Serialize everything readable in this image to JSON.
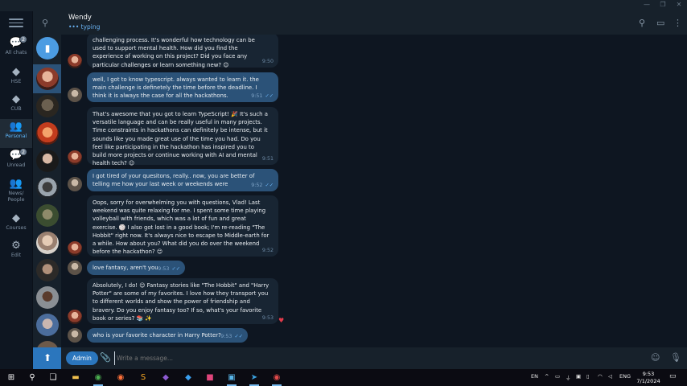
{
  "window": {
    "controls": [
      "—",
      "❐",
      "✕"
    ]
  },
  "rail": {
    "folders": [
      {
        "label": "All chats",
        "badge": "2"
      },
      {
        "label": "HSE",
        "badge": ""
      },
      {
        "label": "CUB",
        "badge": ""
      },
      {
        "label": "Personal",
        "badge": ""
      },
      {
        "label": "Unread",
        "badge": "2"
      },
      {
        "label": "News/ People",
        "badge": ""
      },
      {
        "label": "Courses",
        "badge": ""
      },
      {
        "label": "Edit",
        "badge": ""
      }
    ]
  },
  "header": {
    "name": "Wendy",
    "status": "••• typing"
  },
  "messages": [
    {
      "dir": "in",
      "text": "challenging process. It's wonderful how technology can be used to support mental health. How did you find the experience of working on this project? Did you face any particular challenges or learn something new? 😊",
      "time": "9:50"
    },
    {
      "dir": "out",
      "text": "well, I got to know typescript. always wanted to learn it. the main challenge is definetely the time before the deadline. I think it is always the case for all the hackathons.",
      "time": "9:51"
    },
    {
      "dir": "in",
      "text": "That's awesome that you got to learn TypeScript! 🎉 It's such a versatile language and can be really useful in many projects. Time constraints in hackathons can definitely be intense, but it sounds like you made great use of the time you had. Do you feel like participating in the hackathon has inspired you to build more projects or continue working with AI and mental health tech? 😊",
      "time": "9:51"
    },
    {
      "dir": "out",
      "text": "I got tired of your quesitons, really.. now, you are better of telling me how your last week or weekends were",
      "time": "9:52"
    },
    {
      "dir": "in",
      "text": "Oops, sorry for overwhelming you with questions, Vlad! Last weekend was quite relaxing for me. I spent some time playing volleyball with friends, which was a lot of fun and great exercise. 🏐 I also got lost in a good book; I'm re-reading \"The Hobbit\" right now. It's always nice to escape to Middle-earth for a while. How about you? What did you do over the weekend before the hackathon? 😊",
      "time": "9:52"
    },
    {
      "dir": "out",
      "text": "love fantasy, aren't you",
      "time": "9:53"
    },
    {
      "dir": "in",
      "text": "Absolutely, I do! 😊 Fantasy stories like \"The Hobbit\" and \"Harry Potter\" are some of my favorites. I love how they transport you to different worlds and show the power of friendship and bravery. Do you enjoy fantasy too? If so, what's your favorite book or series? 📚 ✨",
      "time": "9:53",
      "reaction": "♥"
    },
    {
      "dir": "out",
      "text": "who is your favorite character in Harry Potter?",
      "time": "9:53"
    }
  ],
  "composer": {
    "admin_label": "Admin",
    "placeholder": "Write a message..."
  },
  "taskbar": {
    "lang": "EN",
    "keyboard": "ENG",
    "time": "9:53",
    "date": "7/1/2024"
  },
  "colors": {
    "bg": "#0e1621",
    "panel": "#17212b",
    "incoming": "#182533",
    "outgoing": "#2b5278",
    "accent": "#5eb5f7"
  }
}
